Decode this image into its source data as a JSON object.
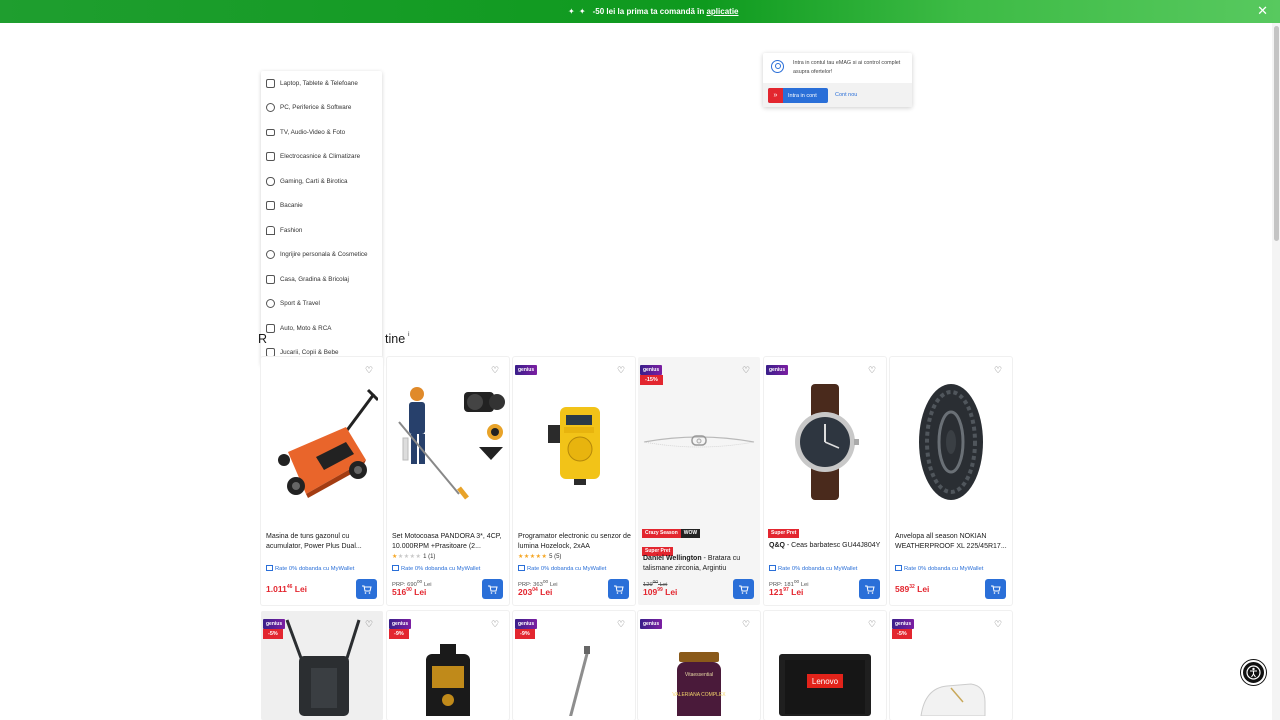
{
  "promo_bar": {
    "stars": "✦ ✦",
    "text": "-50 lei la prima ta comandă în",
    "link": "aplicatie",
    "close": "✕"
  },
  "category_menu": [
    {
      "label": "Laptop, Tablete & Telefoane",
      "icon": "phone-icon"
    },
    {
      "label": "PC, Periferice & Software",
      "icon": "mouse-icon"
    },
    {
      "label": "TV, Audio-Video & Foto",
      "icon": "tv-icon"
    },
    {
      "label": "Electrocasnice & Climatizare",
      "icon": "washing-machine-icon"
    },
    {
      "label": "Gaming, Carti & Birotica",
      "icon": "gamepad-icon"
    },
    {
      "label": "Bacanie",
      "icon": "grocery-bag-icon"
    },
    {
      "label": "Fashion",
      "icon": "tshirt-icon"
    },
    {
      "label": "Ingrijire personala & Cosmetice",
      "icon": "cosmetics-icon"
    },
    {
      "label": "Casa, Gradina & Bricolaj",
      "icon": "sofa-icon"
    },
    {
      "label": "Sport & Travel",
      "icon": "sport-icon"
    },
    {
      "label": "Auto, Moto & RCA",
      "icon": "car-icon"
    },
    {
      "label": "Jucarii, Copii & Bebe",
      "icon": "toy-icon"
    }
  ],
  "login_popup": {
    "text": "Intra in contul tau eMAG si ai control complet asupra ofertelor!",
    "login_button": "Intra in cont",
    "new_account": "Cont nou"
  },
  "section": {
    "title_left": "R",
    "title_right": "tine",
    "info": "i"
  },
  "products_row1": [
    {
      "title": "Masina de tuns gazonul cu acumulator, Power Plus Dual...",
      "wallet": "Rate 0% dobanda cu MyWallet",
      "price_int": "1.011",
      "price_dec": "46",
      "currency": "Lei"
    },
    {
      "title": "Set Motocoasa PANDORA 3*, 4CP, 10.000RPM +Prasitoare (2...",
      "rating_count": "1 (1)",
      "stars_on": "★",
      "stars_off": "★★★★",
      "wallet": "Rate 0% dobanda cu MyWallet",
      "prp": "PRP: 690",
      "prp_dec": "00",
      "prp_cur": "Lei",
      "price_int": "516",
      "price_dec": "00",
      "currency": "Lei"
    },
    {
      "genius": "genius",
      "title": "Programator electronic cu senzor de lumina Hozelock, 2xAA",
      "rating_count": "5 (5)",
      "stars_on": "★★★★★",
      "wallet": "Rate 0% dobanda cu MyWallet",
      "prp": "PRP: 363",
      "prp_dec": "00",
      "prp_cur": "Lei",
      "price_int": "203",
      "price_dec": "04",
      "currency": "Lei"
    },
    {
      "genius": "genius",
      "discount": "-15%",
      "tag1": "Crazy Season",
      "tag1b": "WOW",
      "tag2": "Super Pret",
      "brand": "Daniel Wellington",
      "title": " - Bratara cu talismane zirconia, Argintiu",
      "prp": "129",
      "prp_dec": "00",
      "prp_cur": "Lei",
      "price_int": "109",
      "price_dec": "99",
      "currency": "Lei"
    },
    {
      "genius": "genius",
      "tag2": "Super Pret",
      "brand": "Q&Q",
      "title": " - Ceas barbatesc GU44J804Y",
      "wallet": "Rate 0% dobanda cu MyWallet",
      "prp": "PRP: 181",
      "prp_dec": "00",
      "prp_cur": "Lei",
      "price_int": "121",
      "price_dec": "97",
      "currency": "Lei"
    },
    {
      "title": "Anvelopa all season NOKIAN WEATHERPROOF XL 225/45R17...",
      "wallet": "Rate 0% dobanda cu MyWallet",
      "price_int": "589",
      "price_dec": "32",
      "currency": "Lei"
    }
  ],
  "products_row2": [
    {
      "genius": "genius",
      "discount": "-5%"
    },
    {
      "genius": "genius",
      "discount": "-9%"
    },
    {
      "genius": "genius",
      "discount": "-9%"
    },
    {
      "genius": "genius",
      "product_text": "VALERIANA COMPLEX",
      "brand_text": "Vitaessential"
    },
    {
      "laptop_brand": "Lenovo"
    },
    {
      "genius": "genius",
      "discount": "-5%"
    }
  ],
  "colors": {
    "accent_blue": "#2a6fd8",
    "price_red": "#e3262f",
    "promo_green": "#1f9e2f",
    "star_gold": "#f5a623"
  }
}
